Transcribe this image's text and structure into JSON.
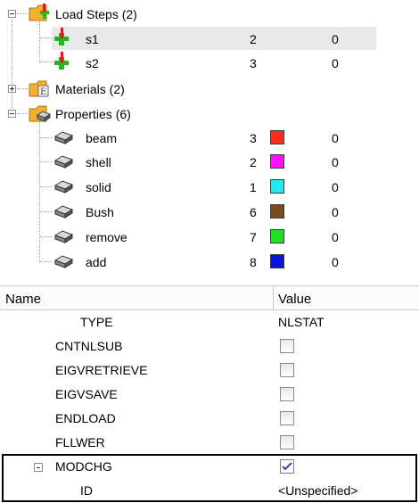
{
  "tree": {
    "load_steps": {
      "label": "Load Steps (2)",
      "items": [
        {
          "label": "s1",
          "id": "2",
          "value": "0"
        },
        {
          "label": "s2",
          "id": "3",
          "value": "0"
        }
      ]
    },
    "materials": {
      "label": "Materials (2)"
    },
    "properties": {
      "label": "Properties (6)",
      "items": [
        {
          "label": "beam",
          "id": "3",
          "color": "#ff2d1f",
          "value": "0"
        },
        {
          "label": "shell",
          "id": "2",
          "color": "#ff10ff",
          "value": "0"
        },
        {
          "label": "solid",
          "id": "1",
          "color": "#28e6f0",
          "value": "0"
        },
        {
          "label": "Bush",
          "id": "6",
          "color": "#7a4a20",
          "value": "0"
        },
        {
          "label": "remove",
          "id": "7",
          "color": "#1fe21f",
          "value": "0"
        },
        {
          "label": "add",
          "id": "8",
          "color": "#0a14d8",
          "value": "0"
        }
      ]
    }
  },
  "grid": {
    "headers": {
      "name": "Name",
      "value": "Value"
    },
    "rows": [
      {
        "name": "TYPE",
        "value": "NLSTAT"
      },
      {
        "name": "CNTNLSUB",
        "checked": false
      },
      {
        "name": "EIGVRETRIEVE",
        "checked": false
      },
      {
        "name": "EIGVSAVE",
        "checked": false
      },
      {
        "name": "ENDLOAD",
        "checked": false
      },
      {
        "name": "FLLWER",
        "checked": false
      },
      {
        "name": "MODCHG",
        "checked": true
      },
      {
        "name": "ID",
        "value": "<Unspecified>"
      }
    ]
  }
}
